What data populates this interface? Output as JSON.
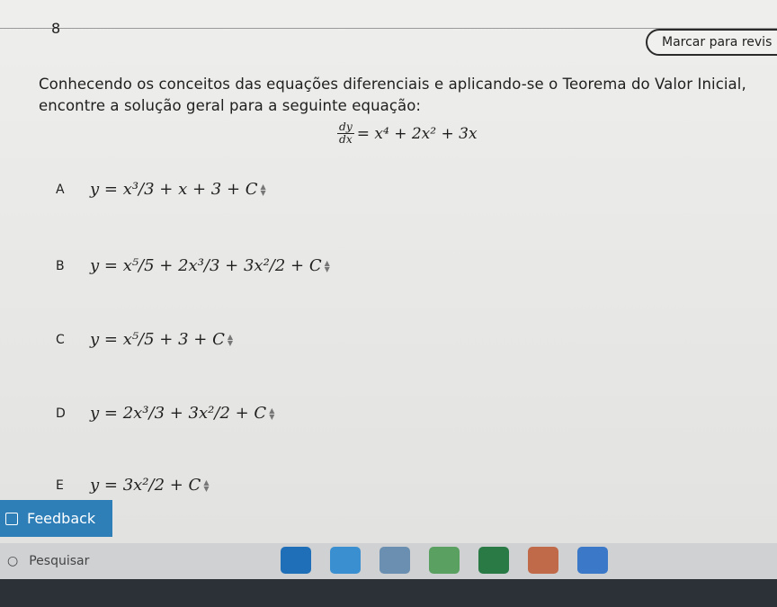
{
  "question": {
    "number": "8",
    "mark_review_label": "Marcar para revis",
    "text": "Conhecendo os conceitos das equações diferenciais e aplicando-se o Teorema do Valor Inicial, encontre a solução geral para a seguinte equação:",
    "equation": {
      "num": "dy",
      "den": "dx",
      "rhs": "= x⁴ + 2x² + 3x"
    }
  },
  "options": [
    {
      "letter": "A",
      "formula": "y = x³/3 + x + 3 + C"
    },
    {
      "letter": "B",
      "formula": "y = x⁵/5 + 2x³/3 + 3x²/2 + C"
    },
    {
      "letter": "C",
      "formula": "y = x⁵/5 + 3 + C"
    },
    {
      "letter": "D",
      "formula": "y = 2x³/3 + 3x²/2 + C"
    },
    {
      "letter": "E",
      "formula": "y = 3x²/2 + C"
    }
  ],
  "feedback": {
    "label": "Feedback"
  },
  "taskbar": {
    "search_placeholder": "Pesquisar",
    "apps": [
      "edge-app",
      "chrome-app",
      "files-app",
      "drive-app",
      "excel-app",
      "browser-app",
      "photos-app"
    ],
    "colors": {
      "accent": "#2e7fb8",
      "taskbar": "#cfd1d3"
    }
  }
}
